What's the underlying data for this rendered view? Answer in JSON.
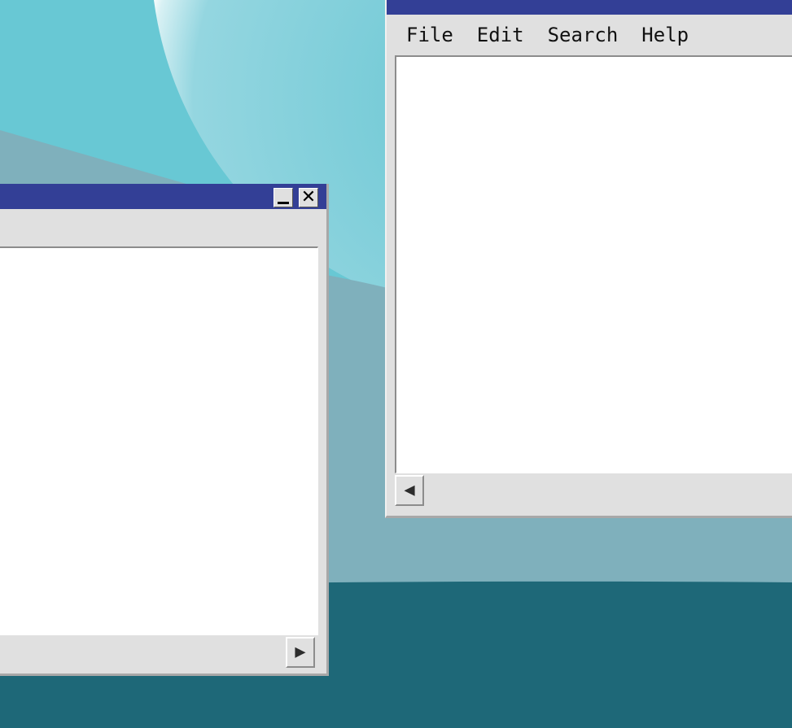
{
  "desktop": {
    "colors": {
      "sky": "#68c8d4",
      "planet_edge": "#ffffff",
      "ground": "#7fb0bc",
      "sea": "#1e6878"
    }
  },
  "left_window": {
    "titlebar_icons": [
      "minimize-icon",
      "close-icon"
    ],
    "minimize_glyph": "",
    "close_glyph": "✕",
    "scroll_right_glyph": "▶"
  },
  "right_window": {
    "menu": {
      "file": "File",
      "edit": "Edit",
      "search": "Search",
      "help": "Help"
    },
    "scroll_left_glyph": "◀"
  },
  "colors": {
    "titlebar": "#333f96",
    "window_face": "#e0e0e0",
    "content_bg": "#ffffff"
  }
}
